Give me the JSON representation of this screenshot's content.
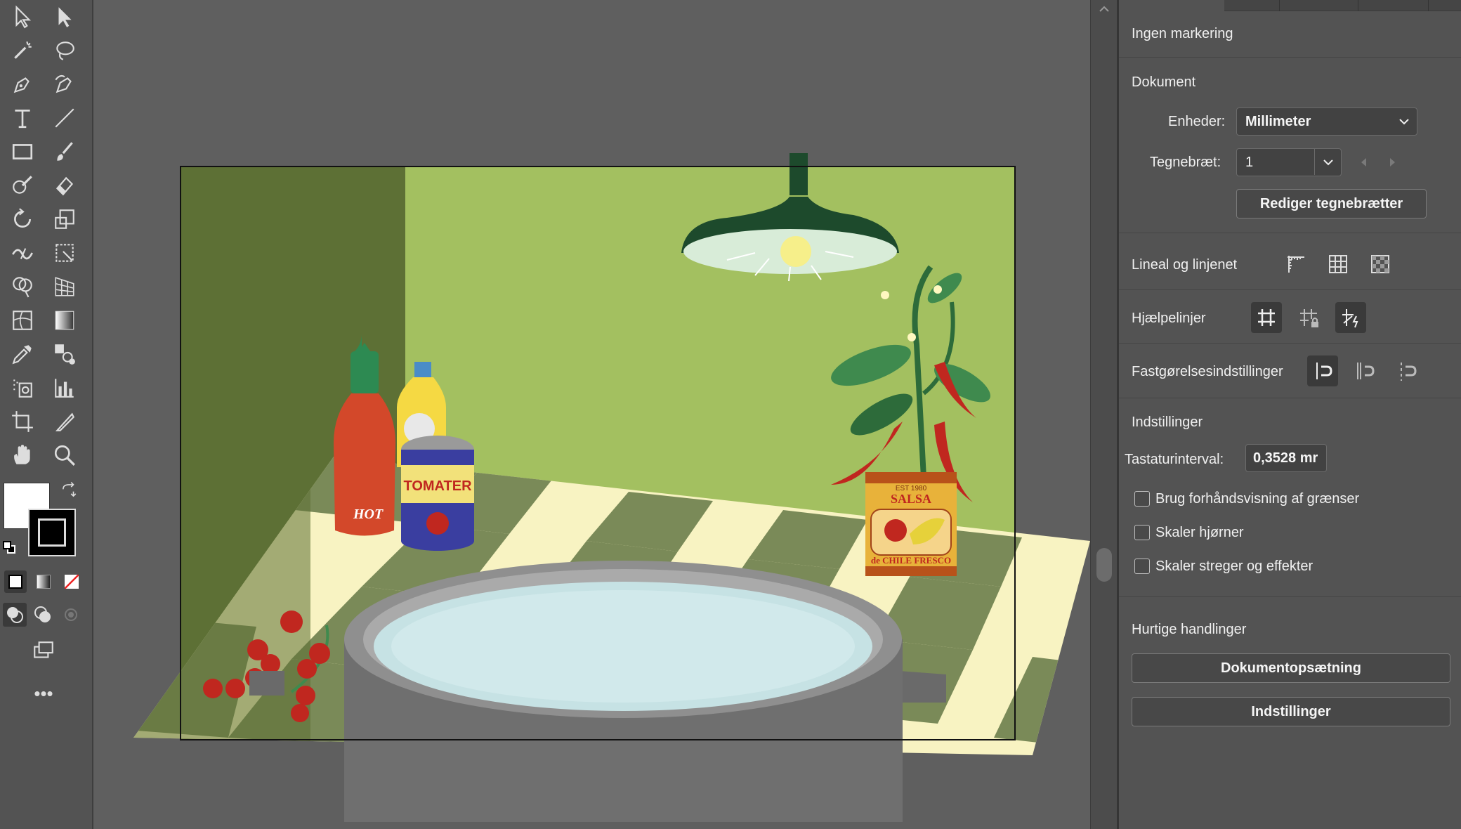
{
  "panel": {
    "selection_title": "Ingen markering",
    "document_section": "Dokument",
    "units_label": "Enheder:",
    "units_value": "Millimeter",
    "artboard_label": "Tegnebræt:",
    "artboard_value": "1",
    "edit_artboards_button": "Rediger tegnebrætter",
    "rulers_grids_label": "Lineal og linjenet",
    "guides_label": "Hjælpelinjer",
    "snap_options_label": "Fastgørelsesindstillinger",
    "preferences_section": "Indstillinger",
    "keyboard_increment_label": "Tastaturinterval:",
    "keyboard_increment_value": "0,3528 mr",
    "checkboxes": [
      {
        "label": "Brug forhåndsvisning af grænser",
        "checked": false
      },
      {
        "label": "Skaler hjørner",
        "checked": false
      },
      {
        "label": "Skaler streger og effekter",
        "checked": false
      }
    ],
    "quick_actions_section": "Hurtige handlinger",
    "document_setup_button": "Dokumentopsætning",
    "preferences_button": "Indstillinger"
  },
  "artwork_text": {
    "hot_label": "HOT",
    "tin_label": "TOMATER",
    "salsa_top": "EST 1980",
    "salsa_label": "SALSA",
    "salsa_bottom": "de CHILE FRESCO"
  },
  "colors": {
    "accent_wall": "#a3c060",
    "dark_wall": "#5d7035",
    "tile_light": "#f8f3c2",
    "tile_dark": "#7a8a58",
    "lamp": "#1d4a2c",
    "water": "#c6e2e4",
    "pot": "#7a7a7a"
  }
}
